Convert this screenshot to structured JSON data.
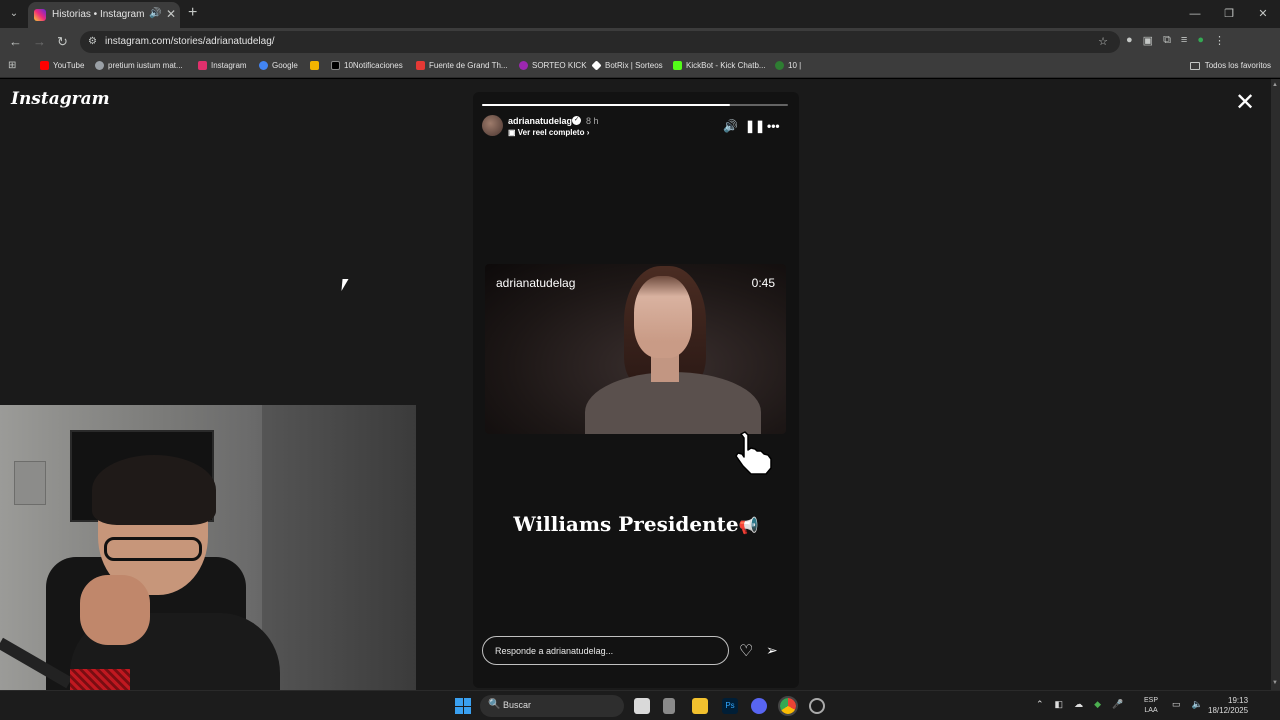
{
  "browser": {
    "tab": {
      "title": "Historias • Instagram"
    },
    "url": "instagram.com/stories/adrianatudelag/",
    "bookmarks": [
      {
        "label": "YouTube",
        "color": "#ff0000"
      },
      {
        "label": "pretium iustum mat...",
        "color": "#9aa0a6"
      },
      {
        "label": "Instagram",
        "color": "#e1306c"
      },
      {
        "label": "Google",
        "color": "#4285f4"
      },
      {
        "label": "",
        "color": "#f4b400"
      },
      {
        "label": "10Notificaciones",
        "color": "#000000"
      },
      {
        "label": "Fuente de Grand Th...",
        "color": "#e53935"
      },
      {
        "label": "SORTEO KICK",
        "color": "#9c27b0"
      },
      {
        "label": "BotRix | Sorteos",
        "color": "#ffffff"
      },
      {
        "label": "KickBot - Kick Chatb...",
        "color": "#53fc18"
      },
      {
        "label": "10 |",
        "color": "#2e7d32"
      }
    ],
    "all_bookmarks": "Todos los favoritos"
  },
  "page": {
    "logo": "Instagram",
    "story": {
      "progress": 0.81,
      "username": "adrianatudelag",
      "time_ago": "8 h",
      "reel_link": "Ver reel completo",
      "reel_username": "adrianatudelag",
      "reel_duration": "0:45",
      "caption": "Williams Presidente",
      "caption_emoji": "📢",
      "reply_placeholder": "Responde a adrianatudelag..."
    }
  },
  "taskbar": {
    "search_label": "Buscar",
    "language_line1": "ESP",
    "language_line2": "LAA",
    "time": "19:13",
    "date": "18/12/2025"
  }
}
